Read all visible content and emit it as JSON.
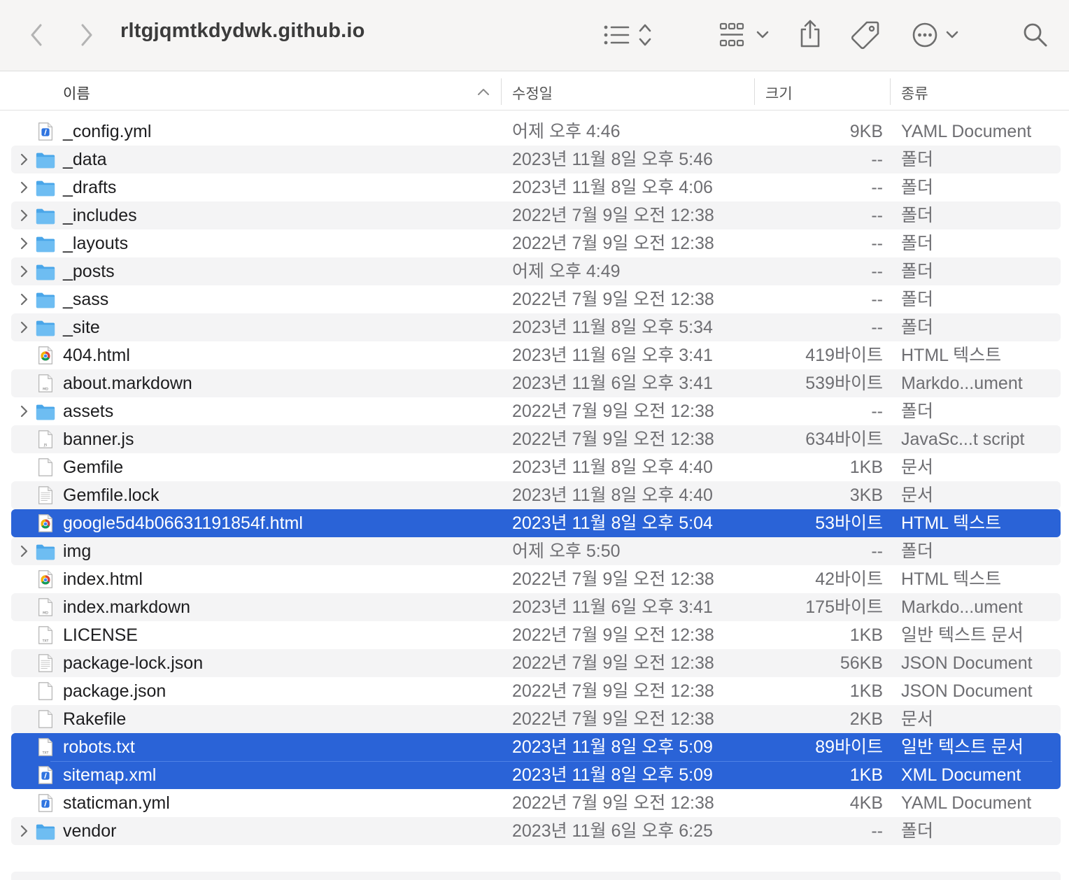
{
  "toolbar": {
    "title": "rltgjqmtkdydwk.github.io",
    "back_icon": "chevron-left-icon",
    "forward_icon": "chevron-right-icon",
    "view_icon": "list-view-icon",
    "group_icon": "grid-group-icon",
    "share_icon": "share-icon",
    "tag_icon": "tag-icon",
    "more_icon": "ellipsis-circle-icon",
    "search_icon": "magnifier-icon"
  },
  "columns": {
    "name": "이름",
    "date": "수정일",
    "size": "크기",
    "kind": "종류"
  },
  "colors": {
    "selection": "#2a63d7",
    "folder": "#5fb3ee",
    "stripe": "#f4f4f5"
  },
  "files": [
    {
      "name": "_config.yml",
      "date": "어제 오후 4:46",
      "size": "9KB",
      "kind": "YAML Document",
      "icon": "yaml",
      "folder": false,
      "selected": false
    },
    {
      "name": "_data",
      "date": "2023년 11월 8일 오후 5:46",
      "size": "--",
      "kind": "폴더",
      "icon": "folder",
      "folder": true,
      "selected": false
    },
    {
      "name": "_drafts",
      "date": "2023년 11월 8일 오후 4:06",
      "size": "--",
      "kind": "폴더",
      "icon": "folder",
      "folder": true,
      "selected": false
    },
    {
      "name": "_includes",
      "date": "2022년 7월 9일 오전 12:38",
      "size": "--",
      "kind": "폴더",
      "icon": "folder",
      "folder": true,
      "selected": false
    },
    {
      "name": "_layouts",
      "date": "2022년 7월 9일 오전 12:38",
      "size": "--",
      "kind": "폴더",
      "icon": "folder",
      "folder": true,
      "selected": false
    },
    {
      "name": "_posts",
      "date": "어제 오후 4:49",
      "size": "--",
      "kind": "폴더",
      "icon": "folder",
      "folder": true,
      "selected": false
    },
    {
      "name": "_sass",
      "date": "2022년 7월 9일 오전 12:38",
      "size": "--",
      "kind": "폴더",
      "icon": "folder",
      "folder": true,
      "selected": false
    },
    {
      "name": "_site",
      "date": "2023년 11월 8일 오후 5:34",
      "size": "--",
      "kind": "폴더",
      "icon": "folder",
      "folder": true,
      "selected": false
    },
    {
      "name": "404.html",
      "date": "2023년 11월 6일 오후 3:41",
      "size": "419바이트",
      "kind": "HTML 텍스트",
      "icon": "chrome",
      "folder": false,
      "selected": false
    },
    {
      "name": "about.markdown",
      "date": "2023년 11월 6일 오후 3:41",
      "size": "539바이트",
      "kind": "Markdo...ument",
      "icon": "md",
      "folder": false,
      "selected": false
    },
    {
      "name": "assets",
      "date": "2022년 7월 9일 오전 12:38",
      "size": "--",
      "kind": "폴더",
      "icon": "folder",
      "folder": true,
      "selected": false
    },
    {
      "name": "banner.js",
      "date": "2022년 7월 9일 오전 12:38",
      "size": "634바이트",
      "kind": "JavaSc...t script",
      "icon": "js",
      "folder": false,
      "selected": false
    },
    {
      "name": "Gemfile",
      "date": "2023년 11월 8일 오후 4:40",
      "size": "1KB",
      "kind": "문서",
      "icon": "blank",
      "folder": false,
      "selected": false
    },
    {
      "name": "Gemfile.lock",
      "date": "2023년 11월 8일 오후 4:40",
      "size": "3KB",
      "kind": "문서",
      "icon": "lines",
      "folder": false,
      "selected": false
    },
    {
      "name": "google5d4b06631191854f.html",
      "date": "2023년 11월 8일 오후 5:04",
      "size": "53바이트",
      "kind": "HTML 텍스트",
      "icon": "chrome",
      "folder": false,
      "selected": true
    },
    {
      "name": "img",
      "date": "어제 오후 5:50",
      "size": "--",
      "kind": "폴더",
      "icon": "folder",
      "folder": true,
      "selected": false
    },
    {
      "name": "index.html",
      "date": "2022년 7월 9일 오전 12:38",
      "size": "42바이트",
      "kind": "HTML 텍스트",
      "icon": "chrome",
      "folder": false,
      "selected": false
    },
    {
      "name": "index.markdown",
      "date": "2023년 11월 6일 오후 3:41",
      "size": "175바이트",
      "kind": "Markdo...ument",
      "icon": "md",
      "folder": false,
      "selected": false
    },
    {
      "name": "LICENSE",
      "date": "2022년 7월 9일 오전 12:38",
      "size": "1KB",
      "kind": "일반 텍스트 문서",
      "icon": "txt",
      "folder": false,
      "selected": false
    },
    {
      "name": "package-lock.json",
      "date": "2022년 7월 9일 오전 12:38",
      "size": "56KB",
      "kind": "JSON Document",
      "icon": "lines",
      "folder": false,
      "selected": false
    },
    {
      "name": "package.json",
      "date": "2022년 7월 9일 오전 12:38",
      "size": "1KB",
      "kind": "JSON Document",
      "icon": "blank",
      "folder": false,
      "selected": false
    },
    {
      "name": "Rakefile",
      "date": "2022년 7월 9일 오전 12:38",
      "size": "2KB",
      "kind": "문서",
      "icon": "blank",
      "folder": false,
      "selected": false
    },
    {
      "name": "robots.txt",
      "date": "2023년 11월 8일 오후 5:09",
      "size": "89바이트",
      "kind": "일반 텍스트 문서",
      "icon": "txt",
      "folder": false,
      "selected": true
    },
    {
      "name": "sitemap.xml",
      "date": "2023년 11월 8일 오후 5:09",
      "size": "1KB",
      "kind": "XML Document",
      "icon": "yaml",
      "folder": false,
      "selected": true
    },
    {
      "name": "staticman.yml",
      "date": "2022년 7월 9일 오전 12:38",
      "size": "4KB",
      "kind": "YAML Document",
      "icon": "yaml",
      "folder": false,
      "selected": false
    },
    {
      "name": "vendor",
      "date": "2023년 11월 6일 오후 6:25",
      "size": "--",
      "kind": "폴더",
      "icon": "folder",
      "folder": true,
      "selected": false
    }
  ]
}
